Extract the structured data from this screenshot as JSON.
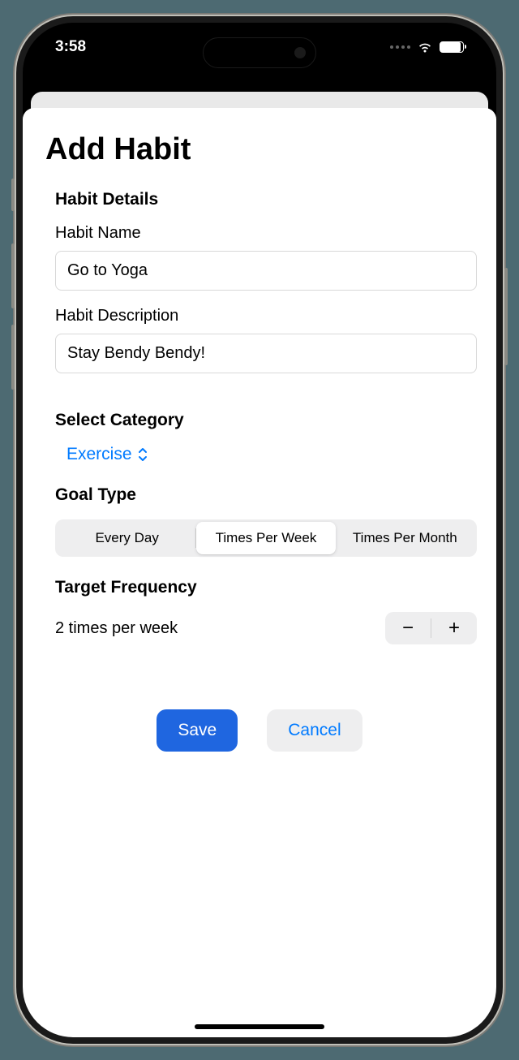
{
  "statusBar": {
    "time": "3:58"
  },
  "pageTitle": "Add Habit",
  "details": {
    "header": "Habit Details",
    "nameLabel": "Habit Name",
    "nameValue": "Go to Yoga",
    "descLabel": "Habit Description",
    "descValue": "Stay Bendy Bendy!"
  },
  "category": {
    "header": "Select Category",
    "selected": "Exercise"
  },
  "goalType": {
    "header": "Goal Type",
    "options": [
      "Every Day",
      "Times Per Week",
      "Times Per Month"
    ],
    "selectedIndex": 1
  },
  "frequency": {
    "header": "Target Frequency",
    "text": "2 times per week",
    "minusLabel": "−",
    "plusLabel": "+"
  },
  "buttons": {
    "save": "Save",
    "cancel": "Cancel"
  }
}
